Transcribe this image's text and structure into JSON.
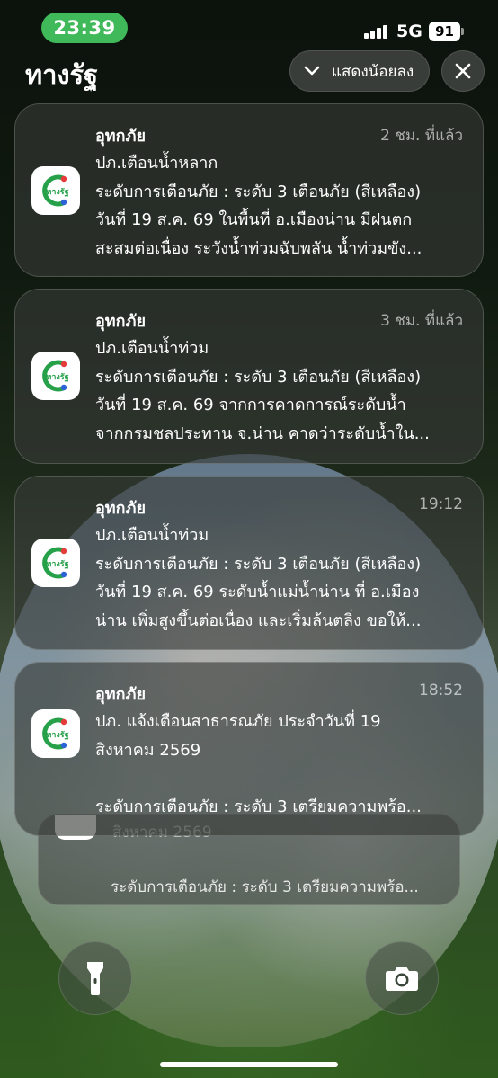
{
  "status_bar": {
    "time": "23:39",
    "network": "5G",
    "battery": "91"
  },
  "header": {
    "app_name": "ทางรัฐ",
    "show_less_label": "แสดงน้อยลง"
  },
  "app_icon_text": "ทางรัฐ",
  "colors": {
    "time_pill": "#3fb95a",
    "icon_green": "#27a04a",
    "dot_red": "#e63b3b",
    "dot_blue": "#2b62d6"
  },
  "notifications": [
    {
      "app": "อุทกภัย",
      "time": "2 ชม. ที่แล้ว",
      "lines": [
        "ปภ.เตือนน้ำหลาก",
        "ระดับการเตือนภัย : ระดับ 3 เตือนภัย (สีเหลือง)",
        "วันที่ 19 ส.ค. 69 ในพื้นที่ อ.เมืองน่าน มีฝนตก",
        "สะสมต่อเนื่อง ระวังน้ำท่วมฉับพลัน น้ำท่วมขัง..."
      ]
    },
    {
      "app": "อุทกภัย",
      "time": "3 ชม. ที่แล้ว",
      "lines": [
        "ปภ.เตือนน้ำท่วม",
        "ระดับการเตือนภัย : ระดับ 3 เตือนภัย (สีเหลือง)",
        "วันที่ 19 ส.ค. 69 จากการคาดการณ์ระดับน้ำ",
        "จากกรมชลประทาน จ.น่าน คาดว่าระดับน้ำใน..."
      ]
    },
    {
      "app": "อุทกภัย",
      "time": "19:12",
      "lines": [
        "ปภ.เตือนน้ำท่วม",
        "ระดับการเตือนภัย : ระดับ 3 เตือนภัย (สีเหลือง)",
        "วันที่ 19 ส.ค. 69 ระดับน้ำแม่น้ำน่าน ที่ อ.เมือง",
        "น่าน เพิ่มสูงขึ้นต่อเนื่อง และเริ่มล้นตลิ่ง ขอให้..."
      ]
    },
    {
      "app": "อุทกภัย",
      "time": "18:52",
      "lines": [
        "ปภ. แจ้งเตือนสาธารณภัย ประจำวันที่ 19",
        "สิงหาคม 2569",
        "",
        "ระดับการเตือนภัย : ระดับ 3 เตรียมความพร้อ..."
      ]
    }
  ],
  "stacked_notification": {
    "partial_text": "สิงหาคม 2569",
    "line": "ระดับการเตือนภัย : ระดับ 3 เตรียมความพร้อ..."
  },
  "bottom": {
    "left_icon": "flashlight-icon",
    "right_icon": "camera-icon"
  }
}
